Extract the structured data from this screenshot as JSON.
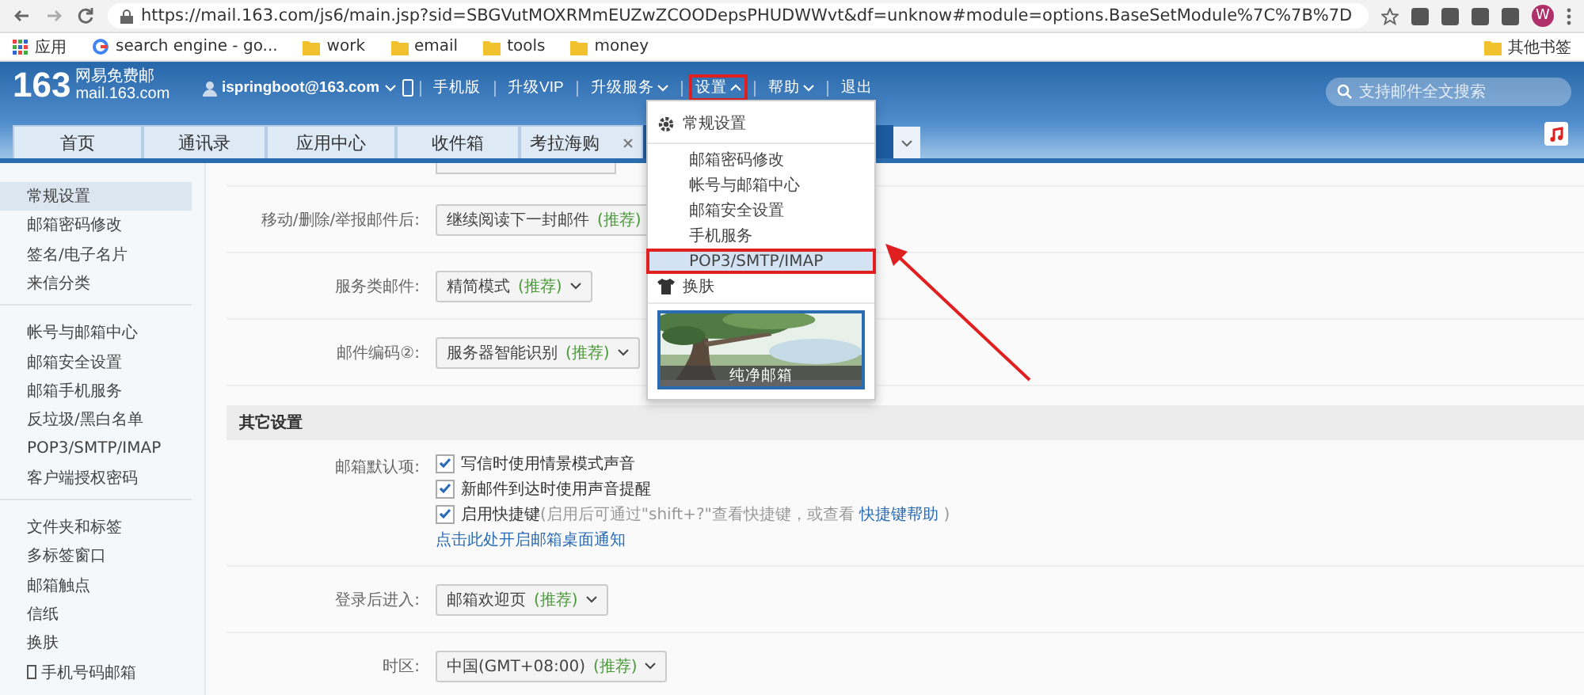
{
  "browser": {
    "url": "https://mail.163.com/js6/main.jsp?sid=SBGVutMOXRMmEUZwZCOODepsPHUDWWvt&df=unknow#module=options.BaseSetModule%7C%7B%7D",
    "profile": "W"
  },
  "bookmarks": [
    {
      "kind": "apps",
      "label": "应用"
    },
    {
      "kind": "site",
      "label": "search engine - go..."
    },
    {
      "kind": "folder",
      "label": "work"
    },
    {
      "kind": "folder",
      "label": "email"
    },
    {
      "kind": "folder",
      "label": "tools"
    },
    {
      "kind": "folder",
      "label": "money"
    }
  ],
  "other_bookmarks": "其他书签",
  "header": {
    "logo": "163",
    "brand": "网易免费邮",
    "domain": "mail.163.com",
    "account": "ispringboot@163.com",
    "nav": [
      {
        "label": "手机版",
        "kind": "link",
        "annotated": false
      },
      {
        "label": "升级VIP",
        "kind": "link",
        "annotated": false
      },
      {
        "label": "升级服务",
        "kind": "menu-closed",
        "annotated": false
      },
      {
        "label": "设置",
        "kind": "menu-open",
        "annotated": true
      },
      {
        "label": "帮助",
        "kind": "menu-closed",
        "annotated": false
      },
      {
        "label": "退出",
        "kind": "link",
        "annotated": false
      }
    ],
    "search": {
      "placeholder": "支持邮件全文搜索"
    }
  },
  "tabs": [
    {
      "label": "首页",
      "closable": false,
      "selected": false
    },
    {
      "label": "通讯录",
      "closable": false,
      "selected": false
    },
    {
      "label": "应用中心",
      "closable": false,
      "selected": false
    },
    {
      "label": "收件箱",
      "closable": false,
      "selected": false
    },
    {
      "label": "考拉海购",
      "closable": true,
      "selected": false
    },
    {
      "selected": true
    }
  ],
  "sidebar": {
    "groups": [
      [
        {
          "label": "常规设置",
          "selected": true
        },
        {
          "label": "邮箱密码修改",
          "selected": false
        },
        {
          "label": "签名/电子名片",
          "selected": false
        },
        {
          "label": "来信分类",
          "selected": false
        }
      ],
      [
        {
          "label": "帐号与邮箱中心",
          "selected": false
        },
        {
          "label": "邮箱安全设置",
          "selected": false
        },
        {
          "label": "邮箱手机服务",
          "selected": false
        },
        {
          "label": "反垃圾/黑白名单",
          "selected": false
        },
        {
          "label": "POP3/SMTP/IMAP",
          "selected": false
        },
        {
          "label": "客户端授权密码",
          "selected": false
        }
      ],
      [
        {
          "label": "文件夹和标签",
          "selected": false
        },
        {
          "label": "多标签窗口",
          "selected": false
        },
        {
          "label": "邮箱触点",
          "selected": false
        },
        {
          "label": "信纸",
          "selected": false
        },
        {
          "label": "换肤",
          "selected": false
        },
        {
          "label": "手机号码邮箱",
          "selected": false,
          "kind": "phone"
        }
      ]
    ]
  },
  "settings": [
    {
      "label": "移动/删除/举报邮件后:",
      "value": "继续阅读下一封邮件",
      "tag": "(推荐)"
    },
    {
      "label": "服务类邮件:",
      "value": "精简模式",
      "tag": "(推荐)"
    },
    {
      "label": "邮件编码②:",
      "value": "服务器智能识别",
      "tag": "(推荐)"
    }
  ],
  "other_section": {
    "title": "其它设置",
    "defaults_label": "邮箱默认项:",
    "checks": [
      {
        "label": "写信时使用情景模式声音",
        "checked": true
      },
      {
        "label": "新邮件到达时使用声音提醒",
        "checked": true
      },
      {
        "label": "启用快捷键",
        "checked": true,
        "hint": "(启用后可通过\"shift+?\"查看快捷键，或查看 ",
        "link": "快捷键帮助",
        "hint_end": " )"
      }
    ],
    "notify_link": "点击此处开启邮箱桌面通知",
    "selects": [
      {
        "label": "登录后进入:",
        "value": "邮箱欢迎页",
        "tag": "(推荐)"
      },
      {
        "label": "时区:",
        "value": "中国(GMT+08:00)",
        "tag": "(推荐)"
      }
    ]
  },
  "settings_menu": {
    "items": [
      {
        "label": "常规设置",
        "kind": "gear",
        "selected": false,
        "annotated": false
      },
      {
        "label": "邮箱密码修改",
        "kind": "plain",
        "selected": false,
        "annotated": false
      },
      {
        "label": "帐号与邮箱中心",
        "kind": "plain",
        "selected": false,
        "annotated": false
      },
      {
        "label": "邮箱安全设置",
        "kind": "plain",
        "selected": false,
        "annotated": false
      },
      {
        "label": "手机服务",
        "kind": "plain",
        "selected": false,
        "annotated": false
      },
      {
        "label": "POP3/SMTP/IMAP",
        "kind": "plain",
        "selected": true,
        "annotated": true
      },
      {
        "label": "换肤",
        "kind": "shirt",
        "selected": false,
        "annotated": false
      }
    ],
    "skin": {
      "kind": "picture",
      "caption": "纯净邮箱"
    }
  }
}
